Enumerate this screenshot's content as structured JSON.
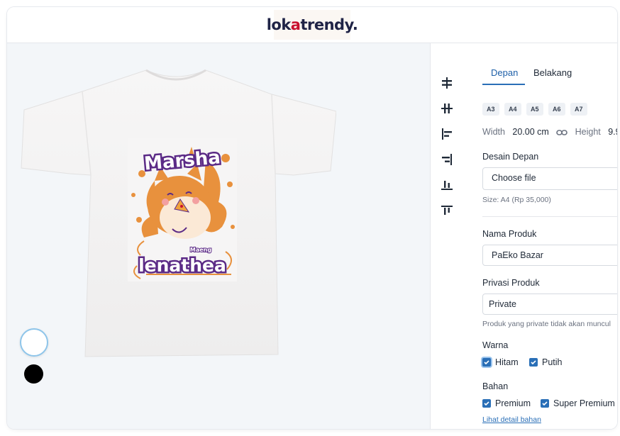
{
  "brand": {
    "logo_part1": "lok",
    "logo_accent": "a",
    "logo_part2": "trendy.",
    "accent_color": "#c8102e",
    "dark_color": "#1f2346"
  },
  "design": {
    "title_top": "Marsha",
    "title_bottom": "lenathea",
    "small_text": "Maeng",
    "colors": {
      "orange": "#e8913d",
      "purple": "#5b2a86",
      "shirt": "#f4f3f3"
    }
  },
  "color_swatches": [
    {
      "name": "white",
      "color": "#ffffff",
      "selected": true
    },
    {
      "name": "black",
      "color": "#000000",
      "selected": false
    }
  ],
  "align_tools": [
    "align-center-vertical-icon",
    "align-center-horizontal-icon",
    "align-left-icon",
    "align-right-icon",
    "align-bottom-icon",
    "align-top-icon"
  ],
  "panel": {
    "tabs": [
      {
        "label": "Depan",
        "active": true
      },
      {
        "label": "Belakang",
        "active": false
      }
    ],
    "sizes": [
      "A3",
      "A4",
      "A5",
      "A6",
      "A7"
    ],
    "width_label": "Width",
    "width_value": "20.00 cm",
    "height_label": "Height",
    "height_value": "9.9",
    "design_label": "Desain Depan",
    "file_button": "Choose file",
    "size_info": "Size: A4 (Rp 35,000)",
    "product_name_label": "Nama Produk",
    "product_name_value": "PaEko Bazar",
    "privacy_label": "Privasi Produk",
    "privacy_value": "Private",
    "privacy_hint": "Produk yang private tidak akan muncul",
    "color_label": "Warna",
    "colors": [
      {
        "label": "Hitam",
        "checked": true
      },
      {
        "label": "Putih",
        "checked": true
      }
    ],
    "material_label": "Bahan",
    "materials": [
      {
        "label": "Premium",
        "checked": true
      },
      {
        "label": "Super Premium",
        "checked": true
      }
    ],
    "material_link": "Lihat detail bahan"
  }
}
